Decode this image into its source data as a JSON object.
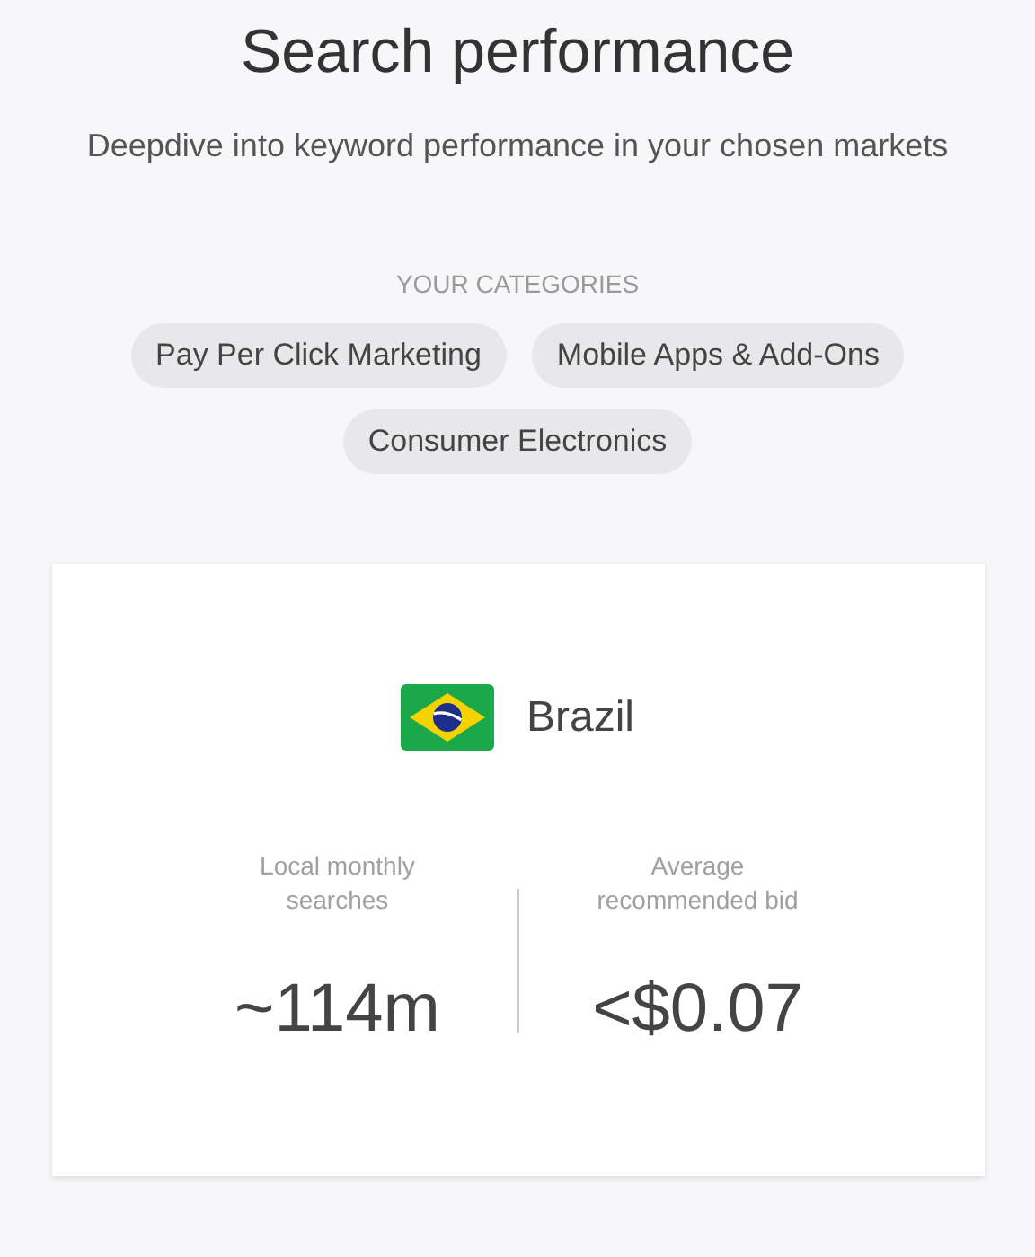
{
  "header": {
    "title": "Search performance",
    "subtitle": "Deepdive into keyword performance in your chosen markets"
  },
  "categories": {
    "label": "YOUR CATEGORIES",
    "items": [
      "Pay Per Click Marketing",
      "Mobile Apps & Add-Ons",
      "Consumer Electronics"
    ]
  },
  "market": {
    "country": "Brazil",
    "metrics": [
      {
        "label": "Local monthly searches",
        "value": "~114m"
      },
      {
        "label": "Average recommended bid",
        "value": "<$0.07"
      }
    ]
  }
}
